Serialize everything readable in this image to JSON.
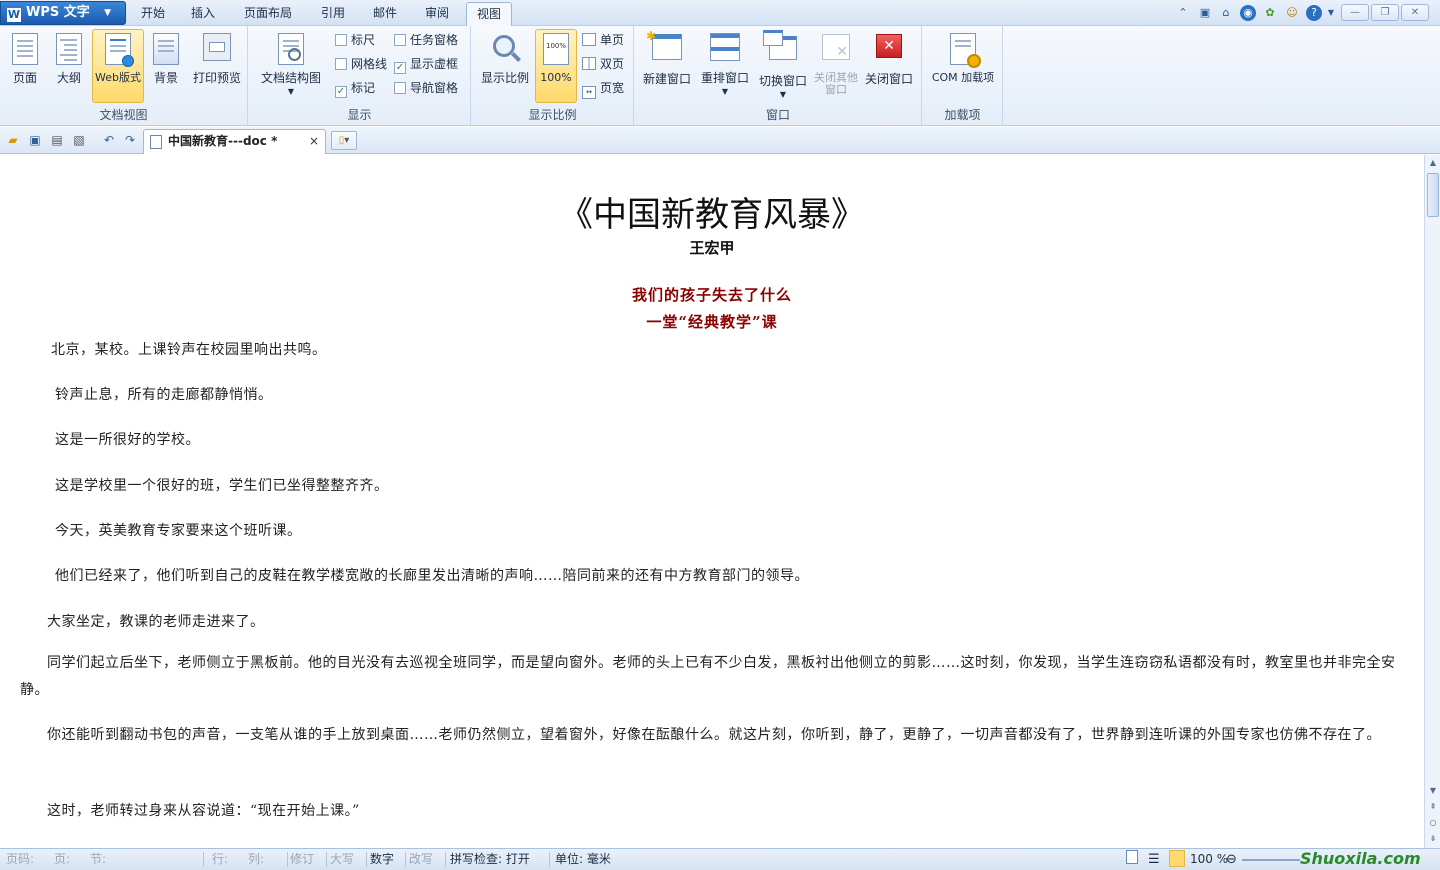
{
  "app": {
    "name": "WPS 文字",
    "logo_letter": "W"
  },
  "menu": {
    "tabs": [
      "开始",
      "插入",
      "页面布局",
      "引用",
      "邮件",
      "审阅",
      "视图"
    ],
    "active_tab": "视图"
  },
  "ribbon": {
    "doc_view": {
      "label": "文档视图",
      "buttons": [
        "页面",
        "大纲",
        "Web版式",
        "背景",
        "打印预览"
      ],
      "active": "Web版式"
    },
    "show": {
      "label": "显示",
      "doc_map": "文档结构图",
      "checks": [
        {
          "label": "标尺",
          "checked": false
        },
        {
          "label": "网格线",
          "checked": false
        },
        {
          "label": "标记",
          "checked": true
        },
        {
          "label": "任务窗格",
          "checked": false
        },
        {
          "label": "显示虚框",
          "checked": true
        },
        {
          "label": "导航窗格",
          "checked": false
        }
      ]
    },
    "zoom": {
      "label": "显示比例",
      "zoom_btn": "显示比例",
      "pct_btn": "100%",
      "single": "单页",
      "double": "双页",
      "page_width": "页宽"
    },
    "window": {
      "label": "窗口",
      "buttons": [
        "新建窗口",
        "重排窗口",
        "切换窗口",
        "关闭其他窗口",
        "关闭窗口"
      ]
    },
    "addins": {
      "label": "加载项",
      "button": "COM 加载项"
    }
  },
  "doc_tab": {
    "title": "中国新教育---doc *",
    "close": "×"
  },
  "document": {
    "title": "《中国新教育风暴》",
    "author": "王宏甲",
    "subtitle1": "我们的孩子失去了什么",
    "subtitle2": "一堂“经典教学”课",
    "paragraphs": [
      "北京，某校。上课铃声在校园里响出共鸣。",
      "铃声止息，所有的走廊都静悄悄。",
      "这是一所很好的学校。",
      "这是学校里一个很好的班，学生们已坐得整整齐齐。",
      "今天，英美教育专家要来这个班听课。",
      "他们已经来了，他们听到自己的皮鞋在教学楼宽敞的长廊里发出清晰的声响……陪同前来的还有中方教育部门的领导。",
      "大家坐定，教课的老师走进来了。",
      "同学们起立后坐下，老师侧立于黑板前。他的目光没有去巡视全班同学，而是望向窗外。老师的头上已有不少白发，黑板衬出他侧立的剪影……这时刻，你发现，当学生连窃窃私语都没有时，教室里也并非完全安静。",
      "你还能听到翻动书包的声音，一支笔从谁的手上放到桌面……老师仍然侧立，望着窗外，好像在酝酿什么。就这片刻，你听到，静了，更静了，一切声音都没有了，世界静到连听课的外国专家也仿佛不存在了。",
      "这时，老师转过身来从容说道：“现在开始上课。”"
    ]
  },
  "status": {
    "page": "页码:",
    "pages": "页:",
    "section": "节:",
    "row": "行:",
    "col": "列:",
    "revise": "修订",
    "caps": "大写",
    "num": "数字",
    "overwrite": "改写",
    "spell": "拼写检查: 打开",
    "unit": "单位: 毫米",
    "zoom": "100 %",
    "watermark": "Shuoxila.com"
  },
  "colors": {
    "accent": "#1a5bb0",
    "subtitle_red": "#8b0000"
  }
}
